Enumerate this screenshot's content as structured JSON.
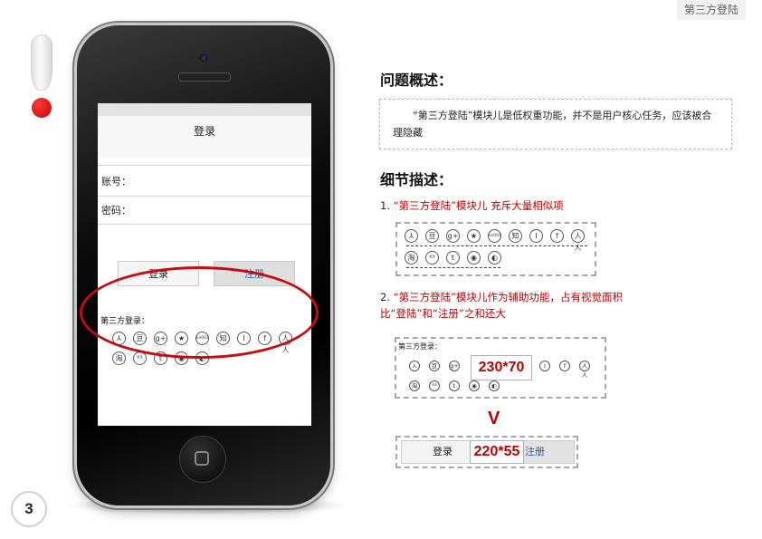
{
  "page_tag": "第三方登陆",
  "page_number": "3",
  "phone": {
    "screen_title": "登录",
    "account_label": "账号：",
    "password_label": "密码：",
    "login_button": "登录",
    "register_button": "注册",
    "third_party_label": "第三方登录：",
    "icons_row1": [
      "flag-icon",
      "douban-icon",
      "google-plus-icon",
      "star-icon",
      "kaixin-icon",
      "zhihu-icon",
      "info-icon",
      "facebook-icon",
      "renren-icon"
    ],
    "icons_row1_glyphs": [
      "⅄",
      "豆",
      "g+",
      "★",
      "kx001",
      "知",
      "I",
      "f",
      "人人"
    ],
    "icons_row2": [
      "taobao-icon",
      "netease-icon",
      "tumblr-icon",
      "weibo-icon",
      "wechat-icon"
    ],
    "icons_row2_glyphs": [
      "淘",
      "⁶³",
      "t",
      "◉",
      "◐"
    ]
  },
  "problem": {
    "heading": "问题概述：",
    "text": "“第三方登陆”模块儿是低权重功能，并不是用户核心任务，应该被合理隐藏"
  },
  "detail": {
    "heading": "细节描述：",
    "item1_num": "1.",
    "item1_text": "“第三方登陆”模块儿 充斥大量相似项",
    "item2_num": "2.",
    "item2_line1": "“第三方登陆”模块儿作为辅助功能，占有视觉面积",
    "item2_line2": "比“登陆”和“注册”之和还大",
    "box2_label": "第三方登录：",
    "dim1": "230*70",
    "dim2": "220*55",
    "box3_login": "登录",
    "box3_register": "注册",
    "arrow": "V"
  },
  "colors": {
    "accent_red": "#c00000",
    "ellipse_red": "#c80a10"
  }
}
